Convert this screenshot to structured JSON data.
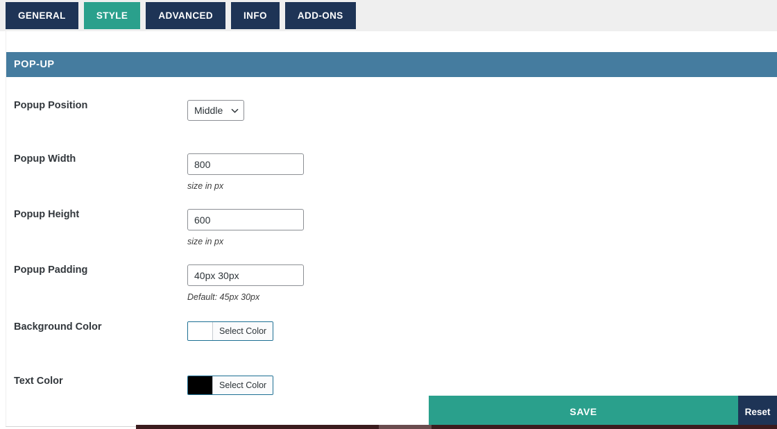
{
  "tabs": [
    {
      "label": "GENERAL",
      "active": false
    },
    {
      "label": "STYLE",
      "active": true
    },
    {
      "label": "ADVANCED",
      "active": false
    },
    {
      "label": "INFO",
      "active": false
    },
    {
      "label": "ADD-ONS",
      "active": false
    }
  ],
  "section": {
    "title": "POP-UP",
    "header_color": "#457c9f"
  },
  "fields": {
    "popup_position": {
      "label": "Popup Position",
      "value": "Middle",
      "icon": "chevron-down-icon"
    },
    "popup_width": {
      "label": "Popup Width",
      "value": "800",
      "helper": "size in px"
    },
    "popup_height": {
      "label": "Popup Height",
      "value": "600",
      "helper": "size in px"
    },
    "popup_padding": {
      "label": "Popup Padding",
      "value": "40px 30px",
      "helper": "Default: 45px 30px"
    },
    "background_color": {
      "label": "Background Color",
      "button_label": "Select Color",
      "swatch": "#ffffff"
    },
    "text_color": {
      "label": "Text Color",
      "button_label": "Select Color",
      "swatch": "#000000"
    }
  },
  "footer": {
    "save_label": "SAVE",
    "reset_label": "Reset",
    "save_color": "#2aa08c",
    "reset_color": "#1e3456"
  }
}
